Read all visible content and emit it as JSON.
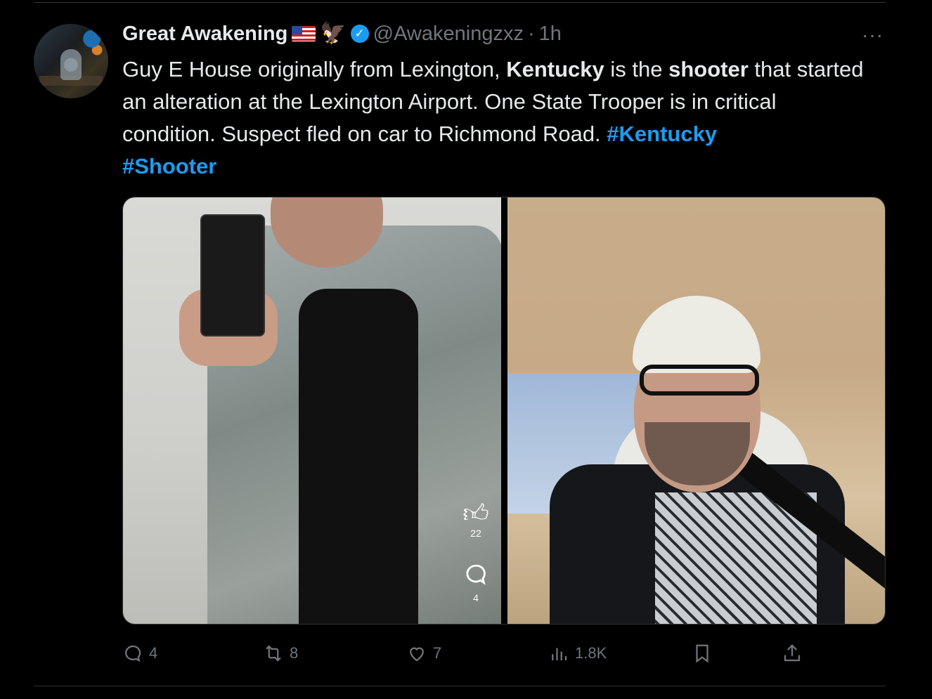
{
  "author": {
    "name": "Great Awakening",
    "emoji_flag": "us-flag-icon",
    "emoji_eagle": "eagle-icon",
    "handle": "@Awakeningzxz",
    "separator": "·",
    "time": "1h"
  },
  "more_label": "···",
  "tweet": {
    "t1": "Guy E House originally from Lexington, ",
    "b1": "Kentucky",
    "t2": " is the ",
    "b2": "shooter",
    "t3": " that started an alteration at the Lexington Airport. One State Trooper is in critical condition. Suspect fled on car to Richmond Road. ",
    "hashtag1": "#Kentucky",
    "hashtag2": "#Shooter"
  },
  "media_overlay": {
    "like_count": "22",
    "comment_count": "4"
  },
  "actions": {
    "replies": "4",
    "reposts": "8",
    "likes": "7",
    "views": "1.8K"
  },
  "colors": {
    "background": "#000000",
    "text": "#e7e9ea",
    "muted": "#71767b",
    "accent": "#1d9bf0"
  }
}
